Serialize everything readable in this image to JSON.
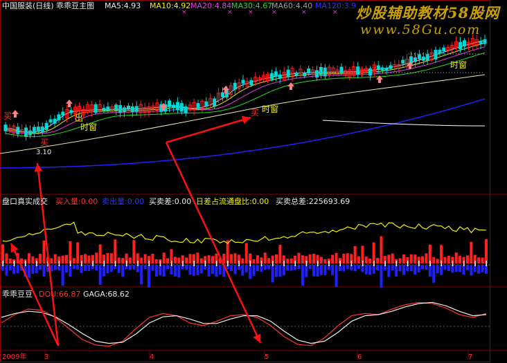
{
  "panel1": {
    "title": "中国服装(日线) 乖乖豆主图",
    "mas": [
      {
        "label": "MA5:4.93",
        "color": "#e8e8e8"
      },
      {
        "label": "MA10:4.92",
        "color": "#f0f000"
      },
      {
        "label": "MA20:4.84",
        "color": "#e040e0"
      },
      {
        "label": "MA30:4.67",
        "color": "#20e020"
      },
      {
        "label": "MA60:4.40",
        "color": "#a0a0a0"
      },
      {
        "label": "MA120:3.9",
        "color": "#3030ff"
      }
    ],
    "annotations": {
      "buy": "买",
      "price_low": "3.10",
      "text_chuzhang": "出",
      "text_dan": "单红",
      "text_shichuang": "时窗"
    }
  },
  "panel2": {
    "title": "盘口真实成交",
    "buy_volume": "买入量:0.00",
    "sell_volume": "卖出量:0.00",
    "diff": "买卖差:0.00",
    "daily_ratio": "日差占流通盘比:0.00",
    "total_diff": "买卖总差:225693.69"
  },
  "panel3": {
    "title": "乖乖豆豆",
    "dou": "DOU:66.87",
    "gaga": "GAGA:68.62"
  },
  "xaxis": {
    "labels": [
      "2009年",
      "3",
      "4",
      "5",
      "6",
      "7"
    ]
  },
  "watermark": {
    "line1": "炒股辅助教材58股网",
    "line2": "www.58Gu.com"
  },
  "colors": {
    "up": "#ff2020",
    "down": "#00d8d8",
    "grid": "#8b0000",
    "yellow": "#f0f000",
    "blue": "#2020ff"
  },
  "chart_data": {
    "type": "line",
    "title": "中国服装(日线)",
    "series": [
      {
        "name": "DOU",
        "values": [
          45,
          60,
          70,
          68,
          55,
          35,
          15,
          5,
          3,
          12,
          35,
          55,
          62,
          58,
          45,
          40,
          48,
          58,
          60,
          55,
          40,
          20,
          6,
          4,
          18,
          40,
          58,
          62,
          60,
          70,
          78,
          82,
          80,
          72,
          60,
          55,
          62
        ]
      },
      {
        "name": "GAGA",
        "values": [
          55,
          62,
          66,
          64,
          56,
          42,
          26,
          12,
          8,
          10,
          25,
          45,
          56,
          58,
          52,
          44,
          44,
          52,
          58,
          58,
          48,
          30,
          14,
          8,
          12,
          28,
          48,
          58,
          60,
          66,
          74,
          80,
          82,
          76,
          66,
          58,
          60
        ]
      }
    ]
  }
}
